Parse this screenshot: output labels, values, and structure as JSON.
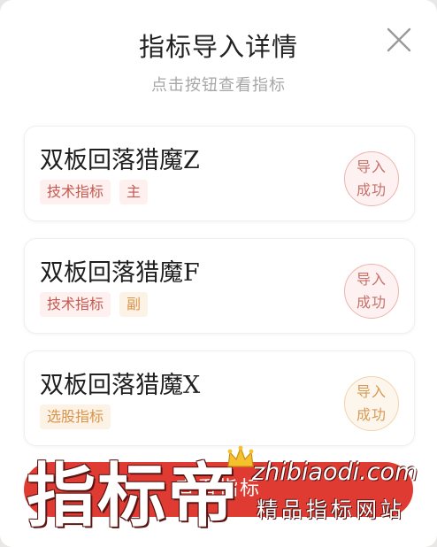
{
  "header": {
    "title": "指标导入详情",
    "subtitle": "点击按钮查看指标"
  },
  "icons": {
    "close": "close-icon",
    "crown": "crown-icon"
  },
  "colors": {
    "accent_red": "#e03b33",
    "tag_red_text": "#c55a52",
    "tag_orange_text": "#d9934a"
  },
  "indicators": [
    {
      "name": "双板回落猎魔Z",
      "tags": [
        "技术指标",
        "主"
      ],
      "status_line1": "导入",
      "status_line2": "成功"
    },
    {
      "name": "双板回落猎魔F",
      "tags": [
        "技术指标",
        "副"
      ],
      "status_line1": "导入",
      "status_line2": "成功"
    },
    {
      "name": "双板回落猎魔X",
      "tags": [
        "选股指标"
      ],
      "status_line1": "导入",
      "status_line2": "成功"
    }
  ],
  "footer": {
    "button_label": "查看指标"
  },
  "watermark": {
    "brand": "指标帝",
    "url": "zhibiaodi.com",
    "slogan": "精品指标网站"
  }
}
